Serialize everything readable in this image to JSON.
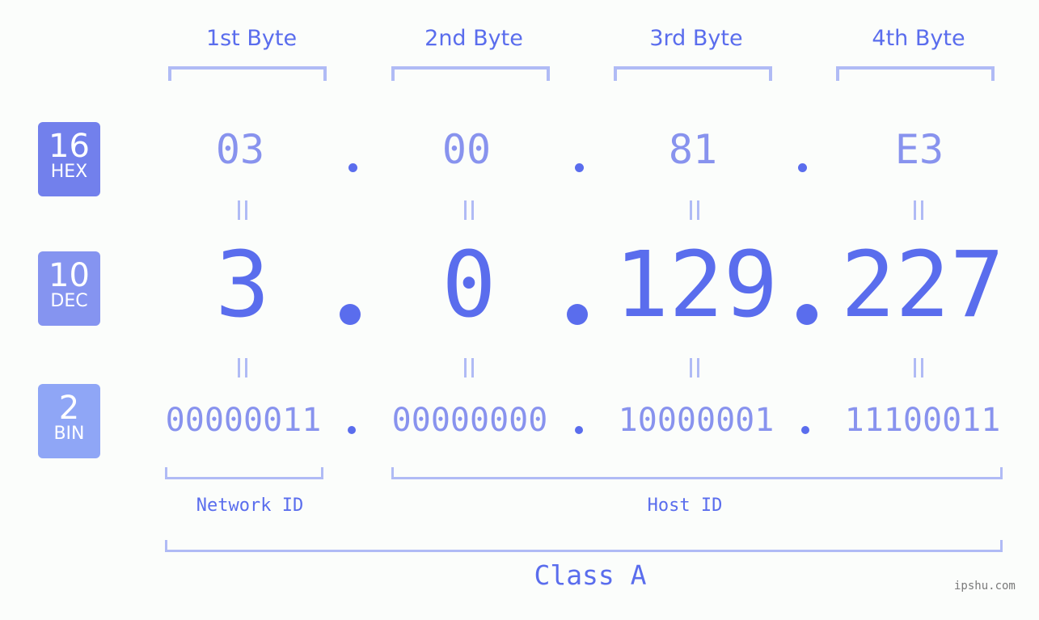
{
  "bytes": [
    {
      "label": "1st Byte",
      "hex": "03",
      "dec": "3",
      "bin": "00000011"
    },
    {
      "label": "2nd Byte",
      "hex": "00",
      "dec": "0",
      "bin": "00000000"
    },
    {
      "label": "3rd Byte",
      "hex": "81",
      "dec": "129",
      "bin": "10000001"
    },
    {
      "label": "4th Byte",
      "hex": "E3",
      "dec": "227",
      "bin": "11100011"
    }
  ],
  "badges": {
    "hex": {
      "num": "16",
      "label": "HEX",
      "color": "#7280ec"
    },
    "dec": {
      "num": "10",
      "label": "DEC",
      "color": "#8594f0"
    },
    "bin": {
      "num": "2",
      "label": "BIN",
      "color": "#8fa6f6"
    }
  },
  "separator": ".",
  "network_label": "Network ID",
  "host_label": "Host ID",
  "class_label": "Class A",
  "watermark": "ipshu.com",
  "colors": {
    "primary": "#5a6ded",
    "secondary": "#8893ee",
    "bracket": "#b0bbf5"
  }
}
